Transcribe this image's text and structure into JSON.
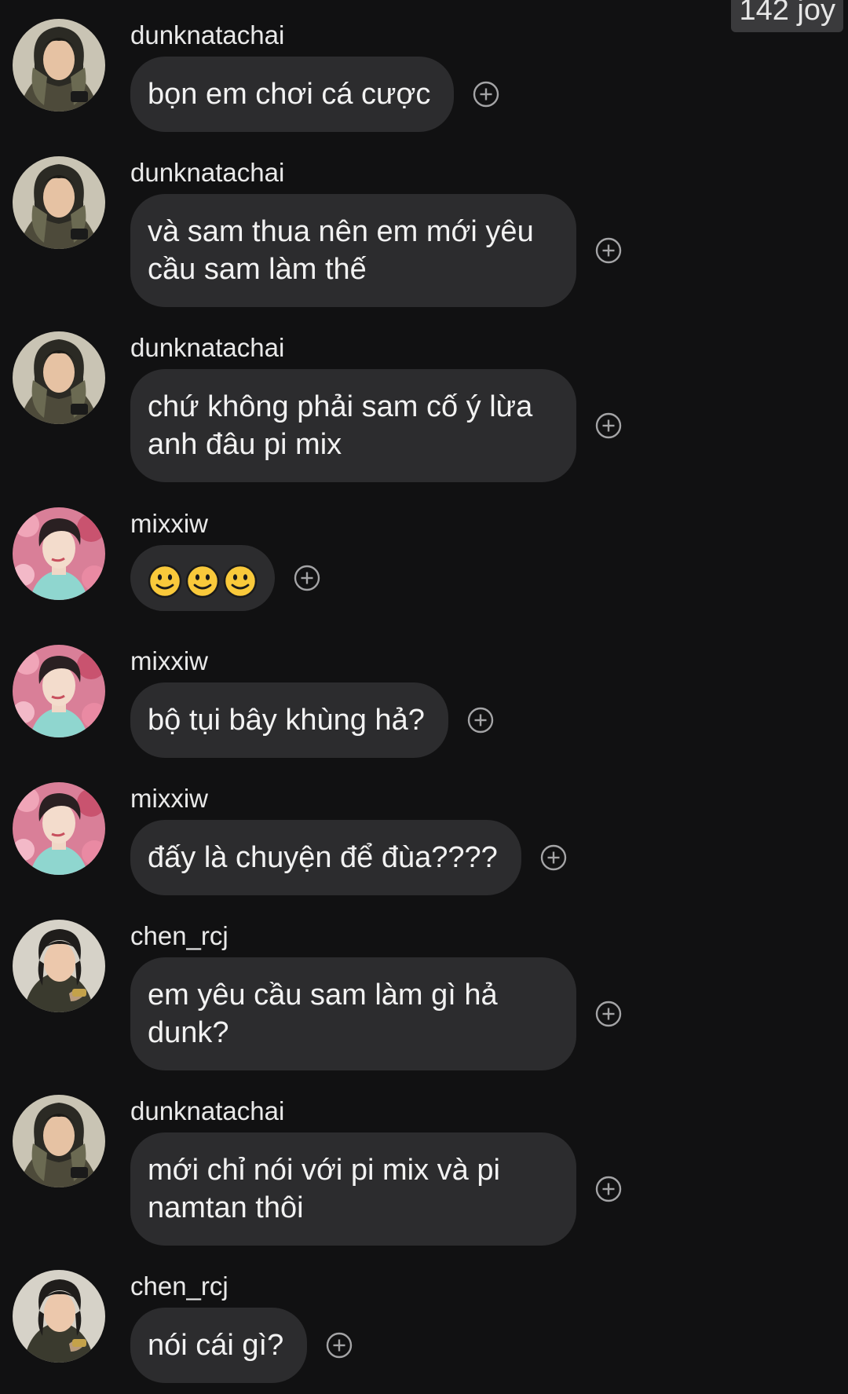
{
  "watermark": "142 joy",
  "colors": {
    "background": "#111112",
    "bubble": "#2c2c2e",
    "text": "#f2f2f2"
  },
  "messages": [
    {
      "user": "dunknatachai",
      "text": "bọn em chơi cá cược",
      "avatar": "avatar-dunknatachai"
    },
    {
      "user": "dunknatachai",
      "text": "và sam thua nên em mới yêu cầu sam làm thế",
      "avatar": "avatar-dunknatachai"
    },
    {
      "user": "dunknatachai",
      "text": "chứ không phải sam cố ý lừa anh đâu pi mix",
      "avatar": "avatar-dunknatachai"
    },
    {
      "user": "mixxiw",
      "text": "",
      "emoji": [
        "slightly-smiling-face",
        "slightly-smiling-face",
        "slightly-smiling-face"
      ],
      "avatar": "avatar-mixxiw"
    },
    {
      "user": "mixxiw",
      "text": "bộ tụi bây khùng hả?",
      "avatar": "avatar-mixxiw"
    },
    {
      "user": "mixxiw",
      "text": "đấy là chuyện để đùa????",
      "avatar": "avatar-mixxiw"
    },
    {
      "user": "chen_rcj",
      "text": "em yêu cầu sam làm gì hả dunk?",
      "avatar": "avatar-chen_rcj"
    },
    {
      "user": "dunknatachai",
      "text": "mới chỉ nói với pi mix và pi namtan thôi",
      "avatar": "avatar-dunknatachai"
    },
    {
      "user": "chen_rcj",
      "text": "nói cái gì?",
      "avatar": "avatar-chen_rcj"
    }
  ],
  "icons": {
    "react": "add-reaction-icon"
  }
}
